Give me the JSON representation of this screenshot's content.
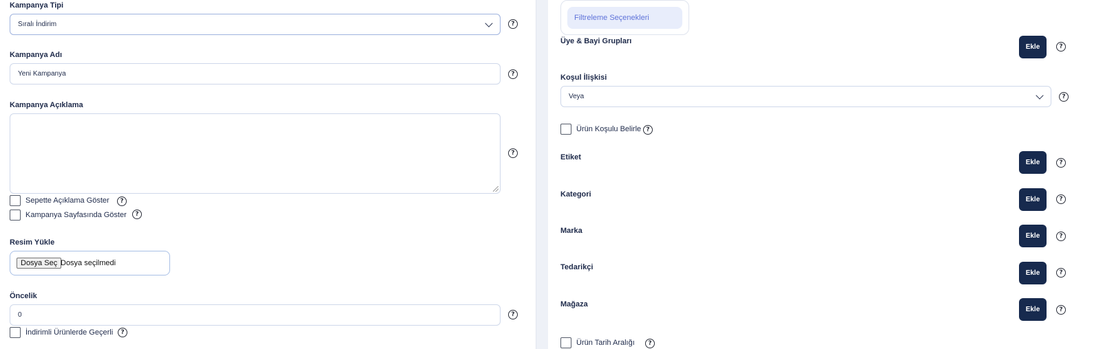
{
  "left": {
    "campaign_type": {
      "label": "Kampanya Tipi",
      "value": "Sıralı İndirim"
    },
    "campaign_name": {
      "label": "Kampanya Adı",
      "value": "Yeni Kampanya"
    },
    "campaign_desc": {
      "label": "Kampanya Açıklama",
      "value": ""
    },
    "show_in_cart": {
      "label": "Sepette Açıklama Göster",
      "checked": false
    },
    "show_on_page": {
      "label": "Kampanya Sayfasında Göster",
      "checked": false
    },
    "image_upload": {
      "label": "Resim Yükle",
      "button": "Dosya Seç",
      "status": "Dosya seçilmedi"
    },
    "priority": {
      "label": "Öncelik",
      "value": "0"
    },
    "discounted_valid": {
      "label": "İndirimli Ürünlerde Geçerli",
      "checked": false
    }
  },
  "right": {
    "tab": {
      "label": "Filtreleme Seçenekleri"
    },
    "member_groups": {
      "label": "Üye & Bayi Grupları",
      "button": "Ekle"
    },
    "condition_relation": {
      "label": "Koşul İlişkisi",
      "value": "Veya"
    },
    "product_condition": {
      "label": "Ürün Koşulu Belirle",
      "checked": false
    },
    "tag": {
      "label": "Etiket",
      "button": "Ekle"
    },
    "category": {
      "label": "Kategori",
      "button": "Ekle"
    },
    "brand": {
      "label": "Marka",
      "button": "Ekle"
    },
    "supplier": {
      "label": "Tedarikçi",
      "button": "Ekle"
    },
    "store": {
      "label": "Mağaza",
      "button": "Ekle"
    },
    "cut_off_label": "Ürün Tarih Aralığı"
  },
  "help_glyph": "?",
  "icons": [
    "help-icon",
    "chevron-down-icon",
    "checkbox"
  ],
  "colors": {
    "accent": "#172a4e",
    "tab_text": "#5f73d9",
    "tab_bg": "#e8edfb",
    "border": "#cfd8ea"
  }
}
